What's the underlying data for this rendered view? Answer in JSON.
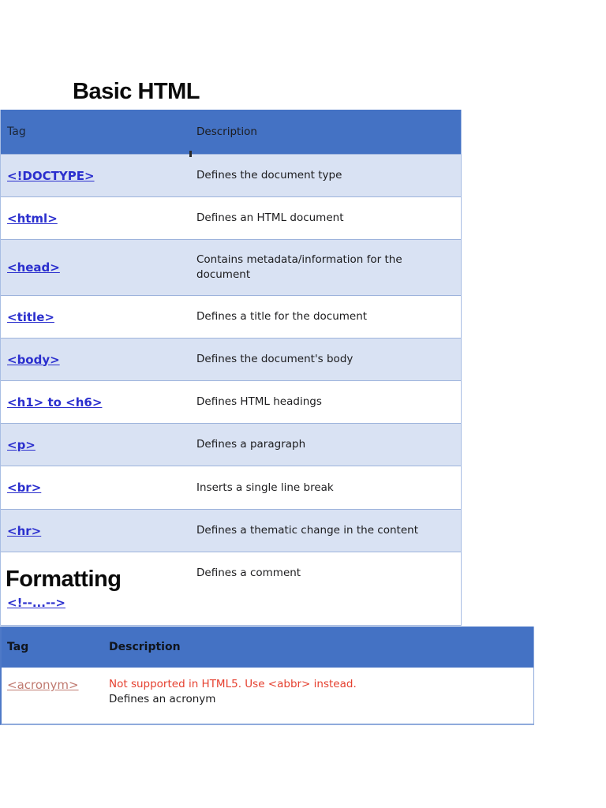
{
  "colors": {
    "header_blue": "#4472c4",
    "row_light_blue": "#d9e2f3",
    "link_blue": "#2b2fce",
    "visited_link_salmon": "#c07a70",
    "warning_red": "#e5402f",
    "page_background": "#ffffff"
  },
  "section_basic": {
    "title": "Basic HTML",
    "table": {
      "col_tag": "Tag",
      "col_description": "Description",
      "rows": [
        {
          "tag": "<!DOCTYPE>",
          "description": "Defines the document type"
        },
        {
          "tag": "<html>",
          "description": "Defines an HTML document"
        },
        {
          "tag": "<head>",
          "description": "Contains metadata/information for the document"
        },
        {
          "tag": "<title>",
          "description": "Defines a title for the document"
        },
        {
          "tag": "<body>",
          "description": "Defines the document's body"
        },
        {
          "tag": "<h1> to <h6>",
          "description": "Defines HTML headings"
        },
        {
          "tag": "<p>",
          "description": "Defines a paragraph"
        },
        {
          "tag": "<br>",
          "description": "Inserts a single line break"
        },
        {
          "tag": "<hr>",
          "description": "Defines a thematic change in the content"
        },
        {
          "tag": "<!--...-->",
          "description": "Defines a comment"
        }
      ]
    }
  },
  "section_formatting": {
    "title": "Formatting",
    "table": {
      "col_tag": "Tag",
      "col_description": "Description",
      "rows": [
        {
          "tag": "<acronym>",
          "note": "Not supported in HTML5. Use <abbr> instead.",
          "description": "Defines an acronym"
        }
      ]
    }
  }
}
